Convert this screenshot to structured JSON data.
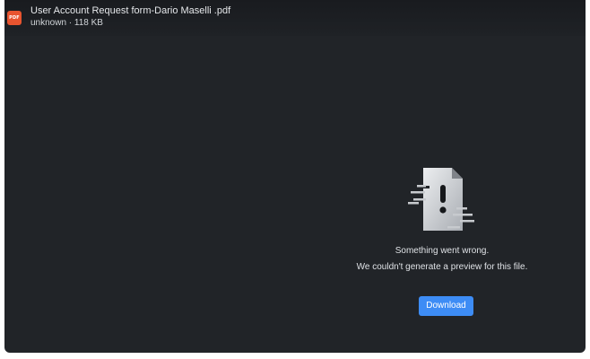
{
  "file": {
    "type_badge": "PDF",
    "name": "User Account Request form-Dario Maselli .pdf",
    "meta": "unknown · 118 KB"
  },
  "error": {
    "icon": "broken-file-icon",
    "title": "Something went wrong.",
    "description": "We couldn't generate a preview for this file."
  },
  "actions": {
    "download_label": "Download"
  },
  "colors": {
    "viewer_bg": "#212428",
    "pdf_badge": "#e8542f",
    "accent": "#3d8cf5",
    "text": "#dfe2e6"
  }
}
